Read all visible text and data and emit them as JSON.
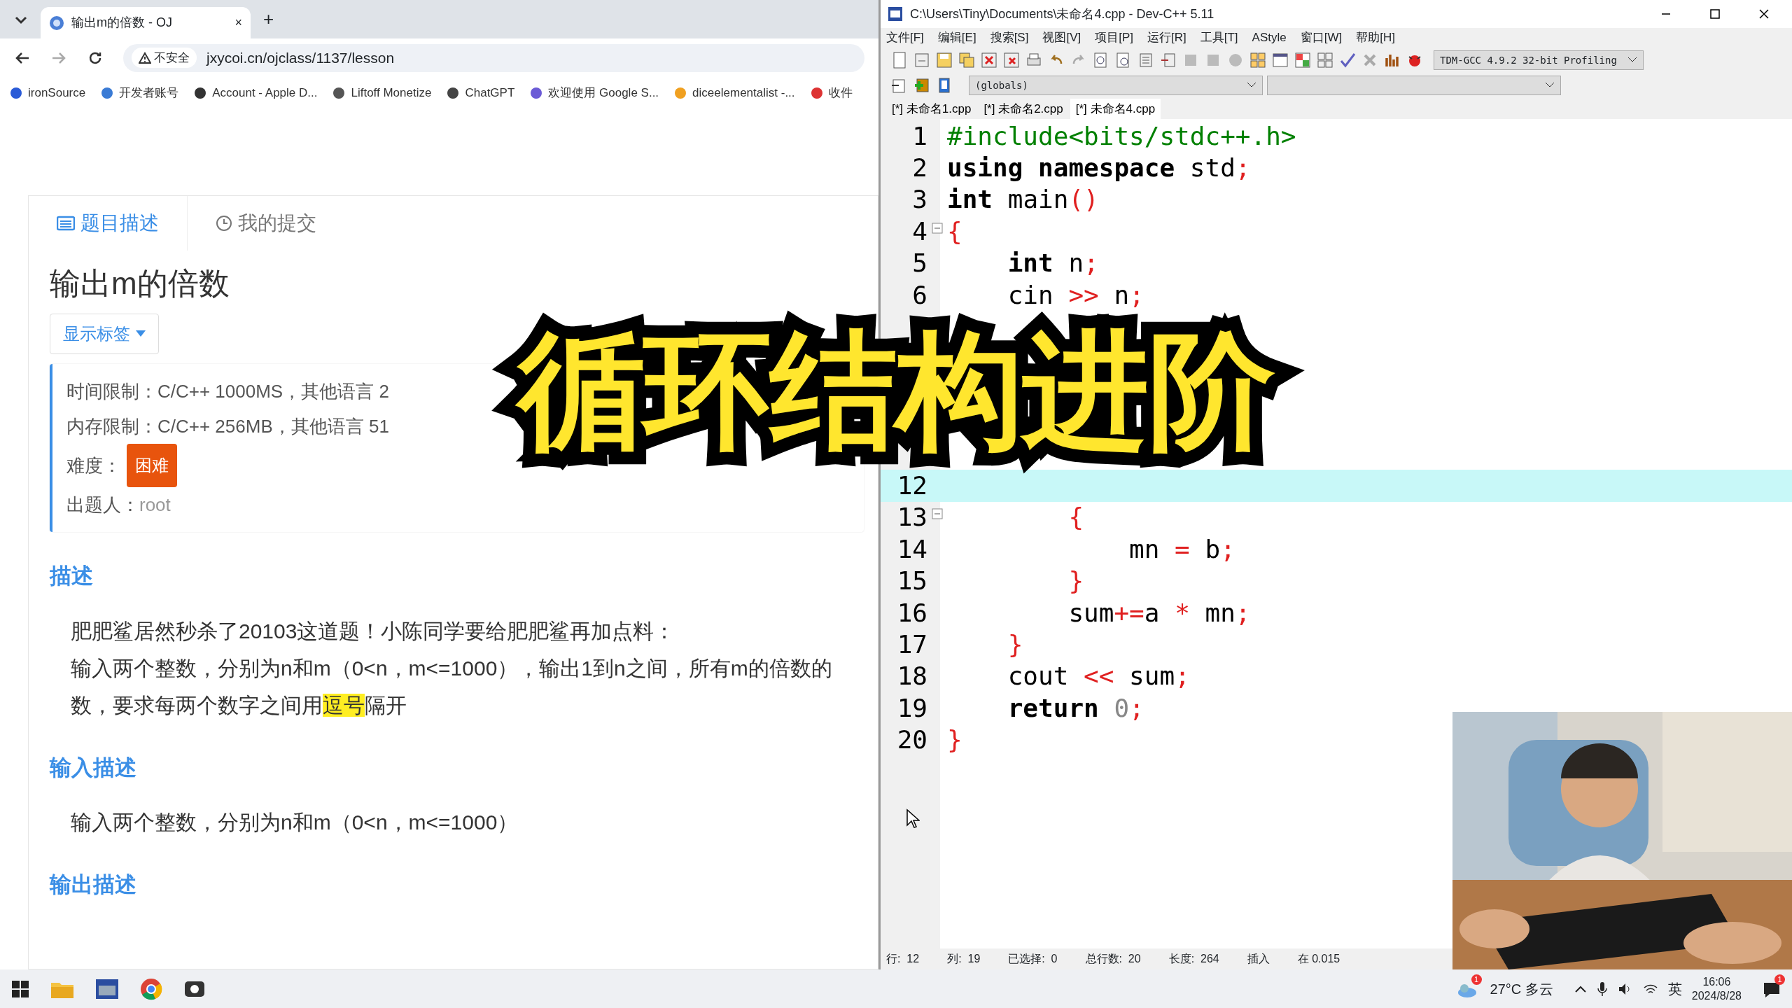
{
  "browser": {
    "tab_title": "输出m的倍数 - OJ",
    "close": "×",
    "new_tab": "+",
    "security": "不安全",
    "url": "jxycoi.cn/ojclass/1137/lesson",
    "bookmarks": [
      "ironSource",
      "开发者账号",
      "Account - Apple D...",
      "Liftoff Monetize",
      "ChatGPT",
      "欢迎使用 Google S...",
      "diceelementalist -...",
      "收件"
    ]
  },
  "problem": {
    "tabs": [
      {
        "label": "题目描述",
        "selected": true
      },
      {
        "label": "我的提交",
        "selected": false
      }
    ],
    "title": "输出m的倍数",
    "tag_button": "显示标签",
    "info": [
      "时间限制：C/C++ 1000MS，其他语言 2",
      "内存限制：C/C++ 256MB，其他语言 51"
    ],
    "difficulty_label": "难度：",
    "difficulty": "困难",
    "author_label": "出题人：",
    "author": "root",
    "sections": [
      {
        "heading": "描述",
        "paragraphs": [
          "肥肥鲨居然秒杀了20103这道题！小陈同学要给肥肥鲨再加点料：",
          "输入两个整数，分别为n和m（0<n，m<=1000），输出1到n之间，所有m的倍数的数，要求每两个数字之间用**逗号**隔开"
        ]
      },
      {
        "heading": "输入描述",
        "paragraphs": [
          "输入两个整数，分别为n和m（0<n，m<=1000）"
        ]
      },
      {
        "heading": "输出描述"
      }
    ]
  },
  "editor": {
    "title": "C:\\Users\\Tiny\\Documents\\未命名4.cpp - Dev-C++ 5.11",
    "menu": [
      "文件[F]",
      "编辑[E]",
      "搜索[S]",
      "视图[V]",
      "项目[P]",
      "运行[R]",
      "工具[T]",
      "AStyle",
      "窗口[W]",
      "帮助[H]"
    ],
    "compiler": "TDM-GCC 4.9.2 32-bit Profiling",
    "scope": "(globals)",
    "files": [
      {
        "label": "[*] 未命名1.cpp",
        "selected": false
      },
      {
        "label": "[*] 未命名2.cpp",
        "selected": false
      },
      {
        "label": "[*] 未命名4.cpp",
        "selected": true
      }
    ],
    "lines": [
      {
        "n": "1",
        "current": false,
        "fold": false,
        "tokens": [
          {
            "kind": "preprocessor",
            "text": "#include<bits/stdc++.h>"
          }
        ]
      },
      {
        "n": "2",
        "current": false,
        "fold": false,
        "tokens": [
          {
            "kind": "keyword",
            "text": "using namespace"
          },
          {
            "kind": "plain",
            "text": " std"
          },
          {
            "kind": "symbol",
            "text": ";"
          }
        ]
      },
      {
        "n": "3",
        "current": false,
        "fold": false,
        "tokens": [
          {
            "kind": "keyword",
            "text": "int"
          },
          {
            "kind": "plain",
            "text": " main"
          },
          {
            "kind": "symbol",
            "text": "()"
          }
        ]
      },
      {
        "n": "4",
        "current": false,
        "fold": true,
        "tokens": [
          {
            "kind": "symbol",
            "text": "{"
          }
        ]
      },
      {
        "n": "5",
        "current": false,
        "fold": false,
        "tokens": [
          {
            "kind": "keyword",
            "text": "    int"
          },
          {
            "kind": "plain",
            "text": " n"
          },
          {
            "kind": "symbol",
            "text": ";"
          }
        ]
      },
      {
        "n": "6",
        "current": false,
        "fold": false,
        "tokens": [
          {
            "kind": "plain",
            "text": "    cin "
          },
          {
            "kind": "symbol",
            "text": ">>"
          },
          {
            "kind": "plain",
            "text": " n"
          },
          {
            "kind": "symbol",
            "text": ";"
          }
        ]
      },
      {
        "current": false,
        "fold": false
      },
      {
        "current": false,
        "fold": false
      },
      {
        "current": false,
        "fold": false
      },
      {
        "current": false,
        "fold": false
      },
      {
        "current": false,
        "fold": false
      },
      {
        "n": "12",
        "current": true,
        "fold": false
      },
      {
        "n": "13",
        "current": false,
        "fold": true,
        "tokens": [
          {
            "kind": "symbol",
            "text": "        {"
          }
        ]
      },
      {
        "n": "14",
        "current": false,
        "fold": false,
        "tokens": [
          {
            "kind": "plain",
            "text": "            mn "
          },
          {
            "kind": "symbol",
            "text": "="
          },
          {
            "kind": "plain",
            "text": " b"
          },
          {
            "kind": "symbol",
            "text": ";"
          }
        ]
      },
      {
        "n": "15",
        "current": false,
        "fold": false,
        "tokens": [
          {
            "kind": "symbol",
            "text": "        }"
          }
        ]
      },
      {
        "n": "16",
        "current": false,
        "fold": false,
        "tokens": [
          {
            "kind": "plain",
            "text": "        sum"
          },
          {
            "kind": "symbol",
            "text": "+="
          },
          {
            "kind": "plain",
            "text": "a "
          },
          {
            "kind": "symbol",
            "text": "*"
          },
          {
            "kind": "plain",
            "text": " mn"
          },
          {
            "kind": "symbol",
            "text": ";"
          }
        ]
      },
      {
        "n": "17",
        "current": false,
        "fold": false,
        "tokens": [
          {
            "kind": "symbol",
            "text": "    }"
          }
        ]
      },
      {
        "n": "18",
        "current": false,
        "fold": false,
        "tokens": [
          {
            "kind": "plain",
            "text": "    cout "
          },
          {
            "kind": "symbol",
            "text": "<<"
          },
          {
            "kind": "plain",
            "text": " sum"
          },
          {
            "kind": "symbol",
            "text": ";"
          }
        ]
      },
      {
        "n": "19",
        "current": false,
        "fold": false,
        "tokens": [
          {
            "kind": "keyword",
            "text": "    return"
          },
          {
            "kind": "number",
            "text": " 0"
          },
          {
            "kind": "symbol",
            "text": ";"
          }
        ]
      },
      {
        "n": "20",
        "current": false,
        "fold": false,
        "tokens": [
          {
            "kind": "symbol",
            "text": "}"
          }
        ]
      }
    ],
    "status": [
      {
        "label": "行:",
        "value": "12"
      },
      {
        "label": "列:",
        "value": "19"
      },
      {
        "label": "已选择:",
        "value": "0"
      },
      {
        "label": "总行数:",
        "value": "20"
      },
      {
        "label": "长度:",
        "value": "264"
      },
      {
        "label": "插入"
      },
      {
        "label": "在 0.015"
      }
    ]
  },
  "overlay_title": "循环结构进阶",
  "taskbar": {
    "weather_badge": "1",
    "weather": "27°C 多云",
    "ime": "英",
    "time": "16:06",
    "date": "2024/8/28",
    "notifications": "1"
  }
}
